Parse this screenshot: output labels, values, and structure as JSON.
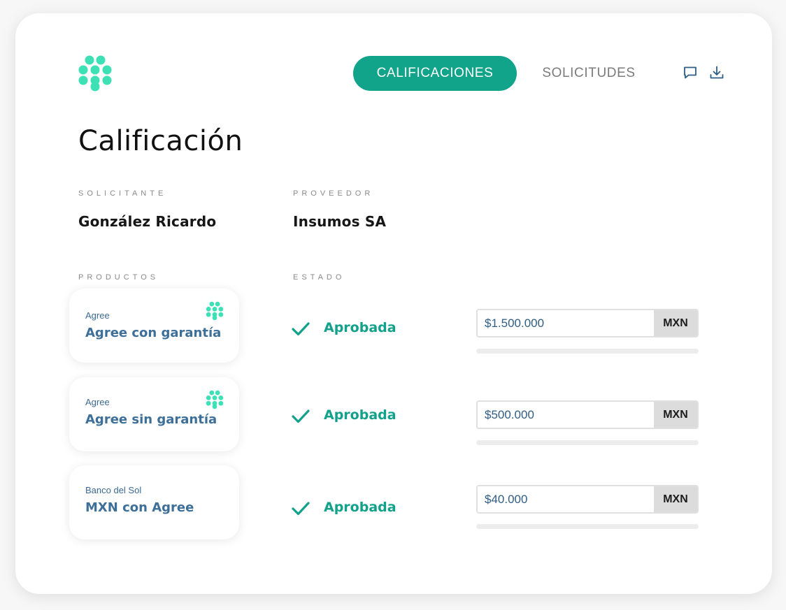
{
  "nav": {
    "tabs": [
      {
        "label": "CALIFICACIONES",
        "active": true
      },
      {
        "label": "SOLICITUDES",
        "active": false
      }
    ],
    "icons": [
      "chat-icon",
      "download-icon"
    ]
  },
  "page": {
    "title": "Calificación"
  },
  "info": {
    "solicitante_label": "SOLICITANTE",
    "solicitante_value": "González Ricardo",
    "proveedor_label": "PROVEEDOR",
    "proveedor_value": "Insumos SA"
  },
  "sections": {
    "productos_label": "PRODUCTOS",
    "estado_label": "ESTADO"
  },
  "products": [
    {
      "subtitle": "Agree",
      "title": "Agree con garantía",
      "has_logo": true,
      "status": "Aprobada",
      "amount": "$1.500.000",
      "currency": "MXN",
      "progress": 0
    },
    {
      "subtitle": "Agree",
      "title": "Agree sin garantía",
      "has_logo": true,
      "status": "Aprobada",
      "amount": "$500.000",
      "currency": "MXN",
      "progress": 0
    },
    {
      "subtitle": "Banco del Sol",
      "title": "MXN con Agree",
      "has_logo": false,
      "status": "Aprobada",
      "amount": "$40.000",
      "currency": "MXN",
      "progress": 0
    }
  ],
  "colors": {
    "accent": "#11a48b",
    "logo": "#3ee0b6",
    "product_text": "#3d6f99"
  }
}
